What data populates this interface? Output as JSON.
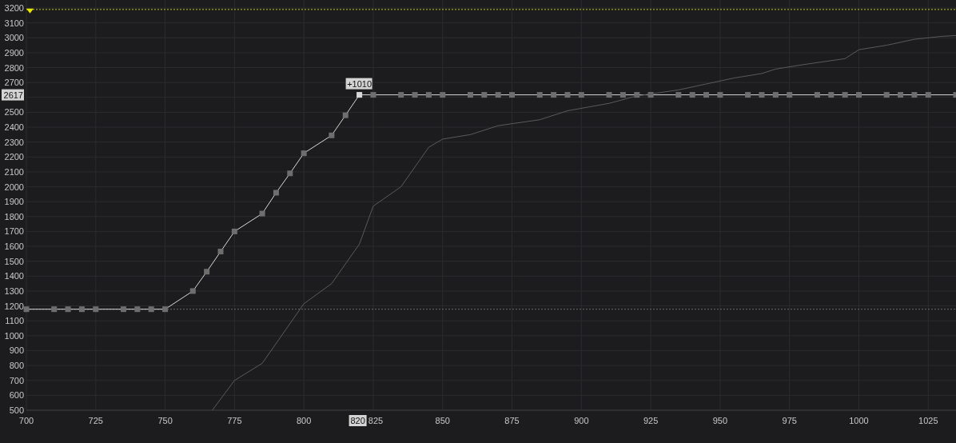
{
  "chart": {
    "chart_data": {
      "type": "line",
      "grid": true,
      "xlim": [
        700,
        1035
      ],
      "ylim": [
        500,
        3200
      ],
      "xticks": [
        700,
        725,
        750,
        775,
        800,
        825,
        850,
        875,
        900,
        925,
        950,
        975,
        1000,
        1025
      ],
      "yticks": [
        500,
        600,
        700,
        800,
        900,
        1000,
        1100,
        1200,
        1300,
        1400,
        1500,
        1600,
        1700,
        1800,
        1900,
        2000,
        2100,
        2200,
        2300,
        2400,
        2500,
        2700,
        2800,
        2900,
        3000,
        3100,
        3200
      ],
      "series": [
        {
          "color": "#d8d8d8",
          "marker": "square",
          "x": [
            700,
            710,
            715,
            720,
            725,
            735,
            740,
            745,
            750,
            760,
            765,
            770,
            775,
            785,
            790,
            795,
            800,
            810,
            815,
            820,
            825,
            835,
            840,
            845,
            850,
            860,
            865,
            870,
            875,
            885,
            890,
            895,
            900,
            910,
            915,
            920,
            925,
            935,
            940,
            945,
            950,
            960,
            965,
            970,
            975,
            985,
            990,
            995,
            1000,
            1010,
            1015,
            1020,
            1025,
            1035
          ],
          "values": [
            1178,
            1178,
            1178,
            1178,
            1178,
            1178,
            1178,
            1178,
            1178,
            1300,
            1430,
            1565,
            1700,
            1820,
            1960,
            2090,
            2225,
            2345,
            2480,
            2617,
            2617,
            2617,
            2617,
            2617,
            2617,
            2617,
            2617,
            2617,
            2617,
            2617,
            2617,
            2617,
            2617,
            2617,
            2617,
            2617,
            2617,
            2617,
            2617,
            2617,
            2617,
            2617,
            2617,
            2617,
            2617,
            2617,
            2617,
            2617,
            2617,
            2617,
            2617,
            2617,
            2617,
            2617
          ]
        },
        {
          "color": "#5a5a5a",
          "x": [
            767,
            775,
            785,
            800,
            810,
            820,
            825,
            835,
            845,
            850,
            860,
            870,
            885,
            895,
            910,
            920,
            935,
            945,
            955,
            965,
            970,
            980,
            995,
            1000,
            1010,
            1020,
            1030,
            1035
          ],
          "values": [
            500,
            700,
            815,
            1215,
            1350,
            1615,
            1870,
            2000,
            2265,
            2320,
            2350,
            2410,
            2450,
            2510,
            2560,
            2610,
            2650,
            2690,
            2730,
            2760,
            2790,
            2820,
            2860,
            2920,
            2950,
            2990,
            3010,
            3015
          ]
        }
      ],
      "ref_lines": [
        {
          "axis": "y",
          "value": 3190,
          "color": "#c8c800"
        },
        {
          "axis": "y",
          "value": 1178,
          "color": "#6a6a6a"
        }
      ],
      "annotations": [
        {
          "x": 820,
          "y": 2617,
          "text": "+1010"
        }
      ]
    },
    "cursor": {
      "y_label": "2617",
      "x_label": "820"
    }
  }
}
